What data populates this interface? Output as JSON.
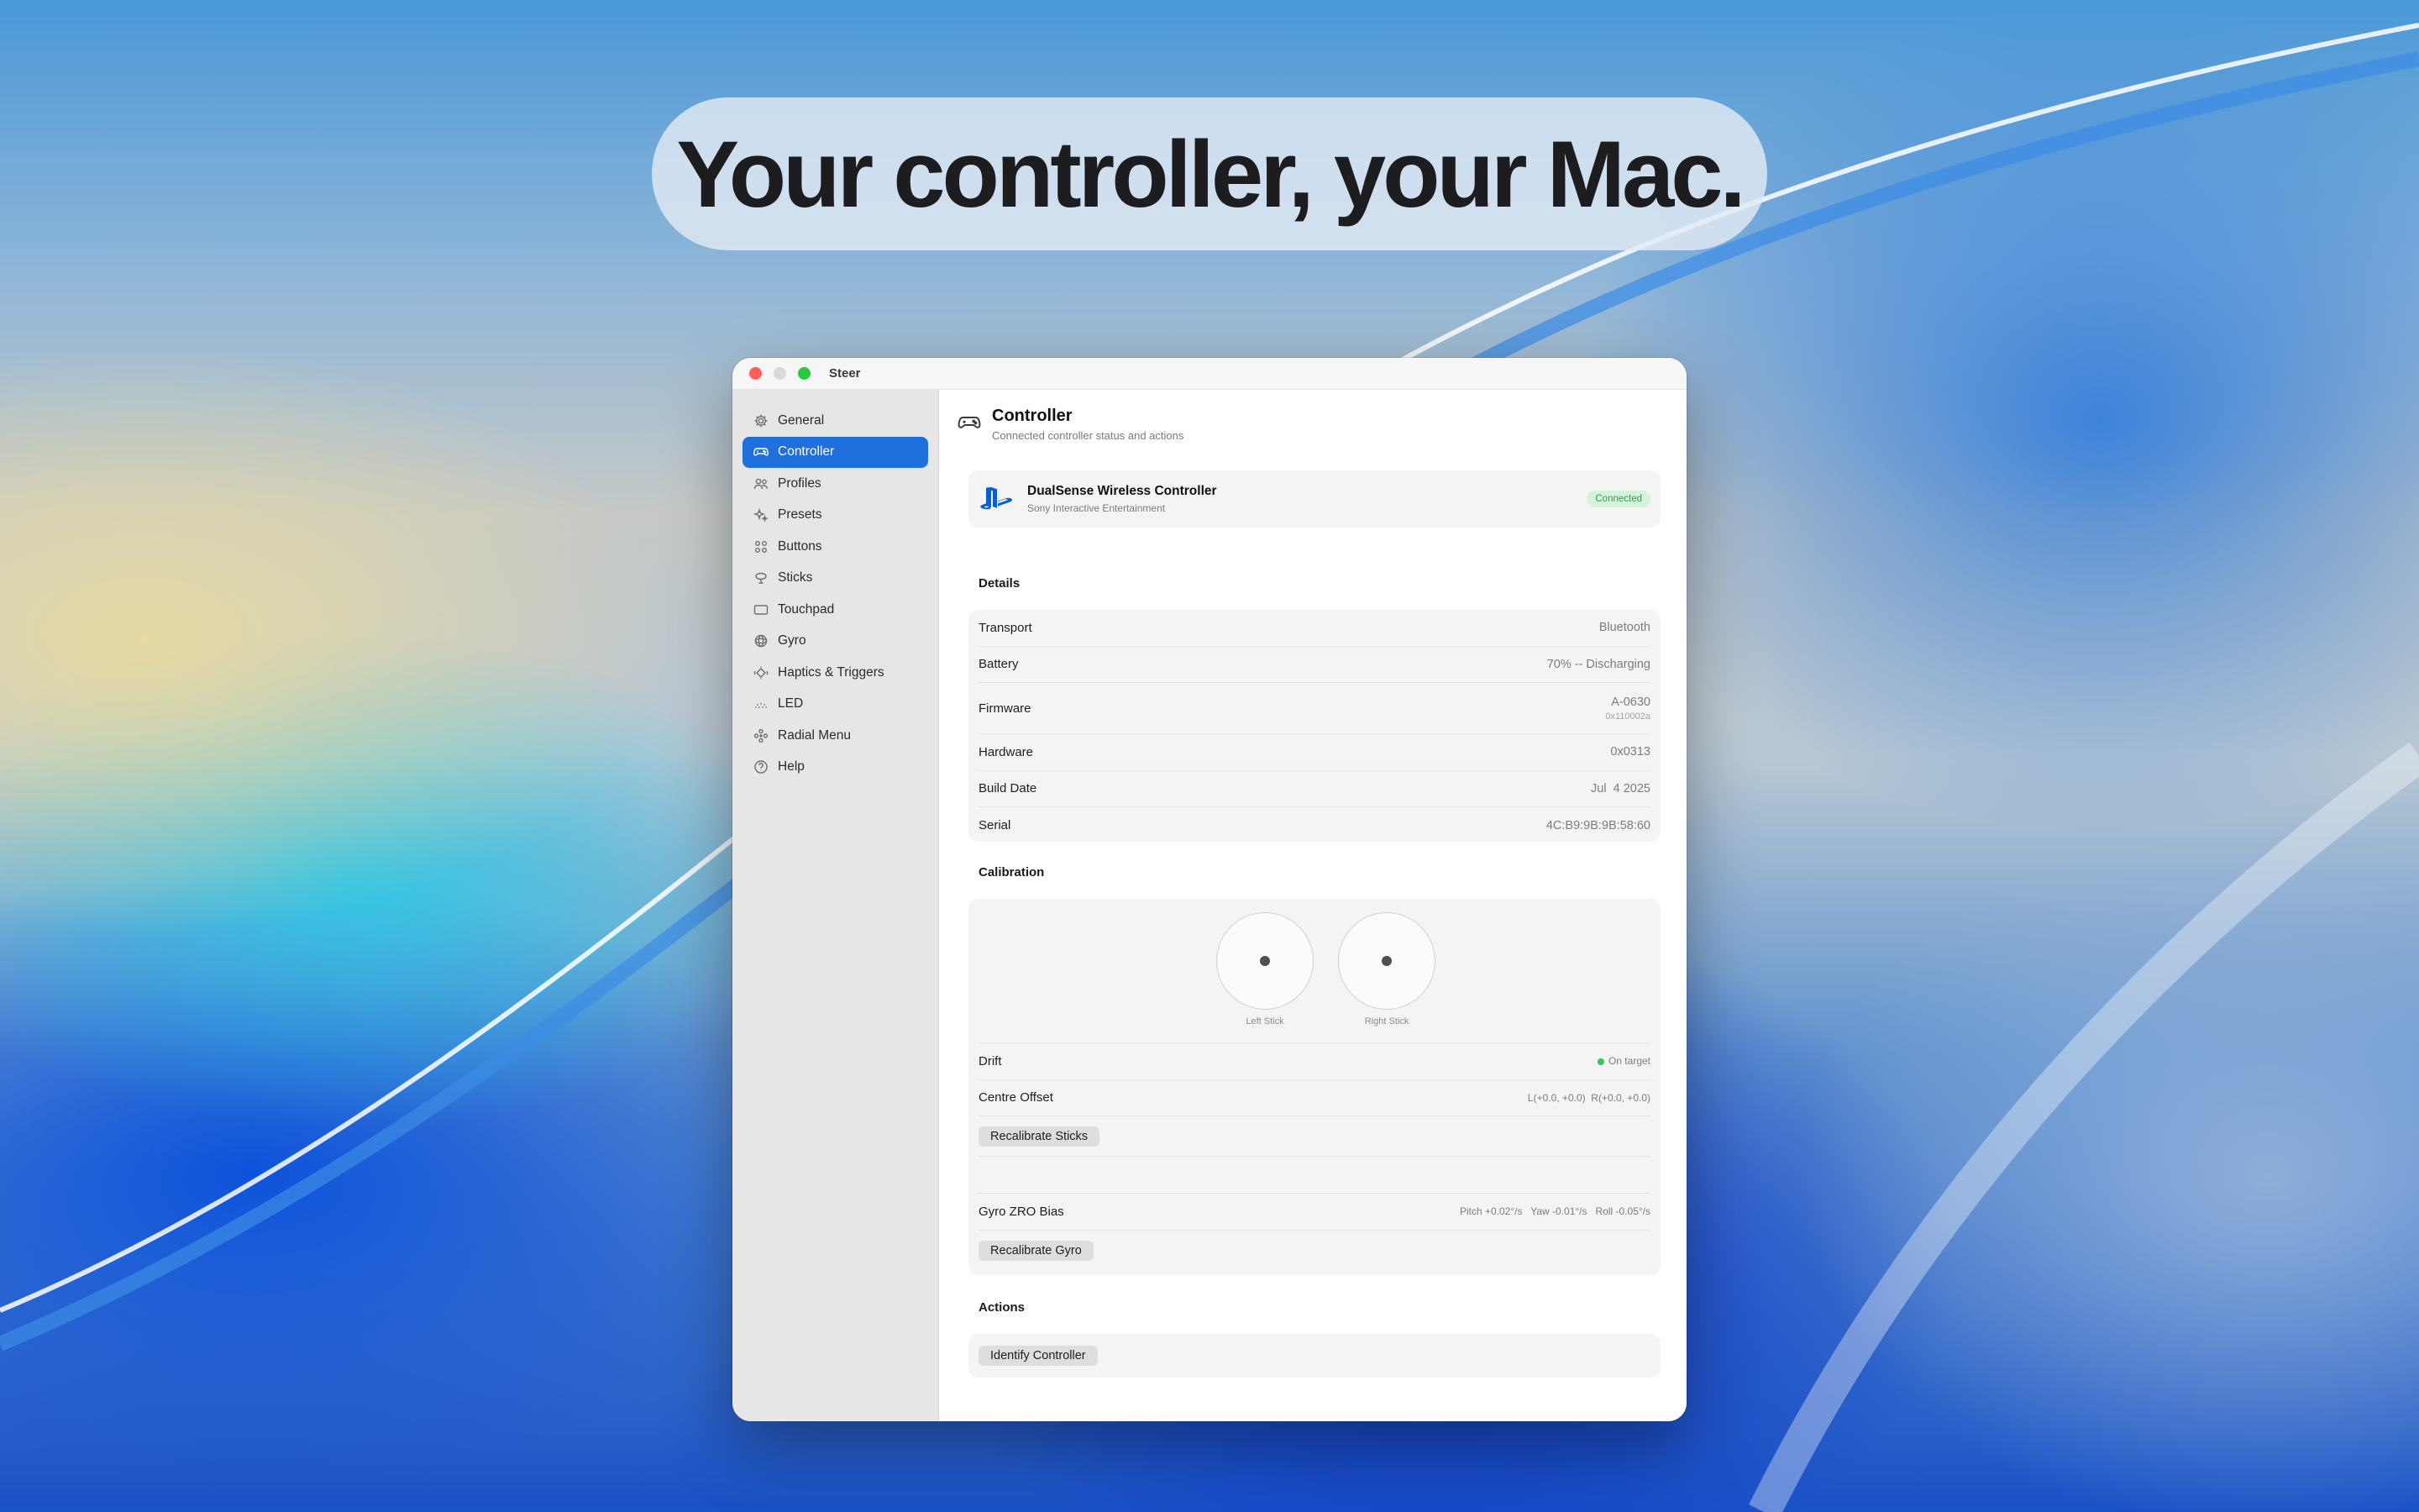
{
  "headline": "Your controller, your Mac.",
  "window": {
    "title": "Steer"
  },
  "sidebar": {
    "items": [
      {
        "label": "General",
        "icon": "gear-icon"
      },
      {
        "label": "Controller",
        "icon": "gamepad-icon",
        "active": true
      },
      {
        "label": "Profiles",
        "icon": "people-icon"
      },
      {
        "label": "Presets",
        "icon": "sparkle-icon"
      },
      {
        "label": "Buttons",
        "icon": "grid-icon"
      },
      {
        "label": "Sticks",
        "icon": "joystick-icon"
      },
      {
        "label": "Touchpad",
        "icon": "rectangle-icon"
      },
      {
        "label": "Gyro",
        "icon": "gyro-icon"
      },
      {
        "label": "Haptics & Triggers",
        "icon": "haptics-icon"
      },
      {
        "label": "LED",
        "icon": "led-icon"
      },
      {
        "label": "Radial Menu",
        "icon": "radial-icon"
      },
      {
        "label": "Help",
        "icon": "question-icon"
      }
    ]
  },
  "main": {
    "title": "Controller",
    "subtitle": "Connected controller status and actions",
    "device": {
      "name": "DualSense Wireless Controller",
      "maker": "Sony Interactive Entertainment",
      "status": "Connected"
    },
    "details": {
      "title": "Details",
      "rows": [
        {
          "label": "Transport",
          "value": "Bluetooth"
        },
        {
          "label": "Battery",
          "value": "70% -- Discharging"
        },
        {
          "label": "Firmware",
          "value": "A-0630",
          "sub": "0x110002a"
        },
        {
          "label": "Hardware",
          "value": "0x0313"
        },
        {
          "label": "Build Date",
          "value": "Jul  4 2025"
        },
        {
          "label": "Serial",
          "value": "4C:B9:9B:9B:58:60"
        }
      ]
    },
    "calibration": {
      "title": "Calibration",
      "left_stick": "Left Stick",
      "right_stick": "Right Stick",
      "drift_label": "Drift",
      "drift_value": "On target",
      "offset_label": "Centre Offset",
      "offset_value": "L(+0.0, +0.0)  R(+0.0, +0.0)",
      "recal_sticks": "Recalibrate Sticks",
      "gyro_label": "Gyro ZRO Bias",
      "gyro_value": "Pitch +0.02°/s   Yaw -0.01°/s   Roll -0.05°/s",
      "recal_gyro": "Recalibrate Gyro"
    },
    "actions": {
      "title": "Actions",
      "identify": "Identify Controller"
    }
  },
  "colors": {
    "accent": "#1f6fdc",
    "connected_bg": "#d6f2dc",
    "connected_fg": "#2f9e4c"
  }
}
